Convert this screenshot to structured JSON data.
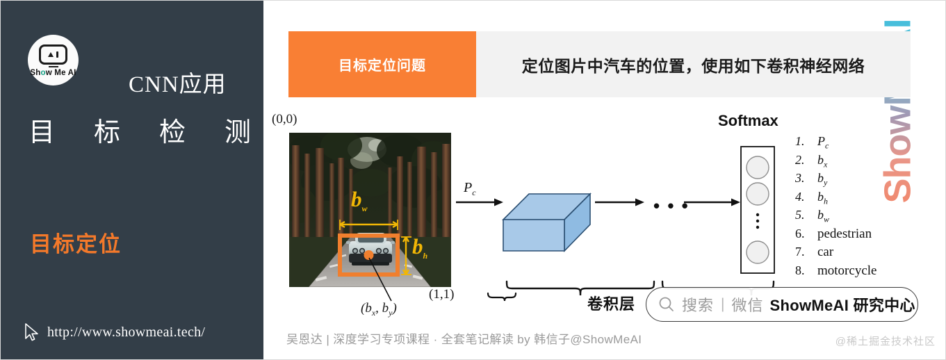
{
  "sidebar": {
    "logo": {
      "icon": "showmeai-robot-logo",
      "wordmark_pre": "Sh",
      "wordmark_dot": "o",
      "wordmark_post": "w Me AI"
    },
    "course_title": "CNN应用",
    "main_title_chars": [
      "目",
      "标",
      "检",
      "测"
    ],
    "sub_title": "目标定位",
    "site_url": "http://www.showmeai.tech/",
    "cursor_icon": "mouse-pointer-icon",
    "bg_color": "#333e48",
    "accent_color": "#f4792a"
  },
  "banner": {
    "tag": "目标定位问题",
    "text": "定位图片中汽车的位置，使用如下卷积神经网络",
    "tag_color": "#f97f34",
    "bg_color": "#f2f2f2"
  },
  "diagram": {
    "origin_label": "(0,0)",
    "end_label": "(1,1)",
    "center_label": "(bx, by)",
    "width_label": "bw",
    "height_label": "bh",
    "input_label": "Pc",
    "ellipsis": "• • •",
    "softmax_label": "Softmax",
    "conv_label": "卷积层",
    "box_color": "#f07f2e",
    "dim_color": "#f2b705",
    "cube_fill": "#a8c9e8",
    "cube_stroke": "#2b4f72",
    "photo_alt": "car-on-forest-road-photo"
  },
  "output_list": {
    "items": [
      {
        "num": "1.",
        "value": "P",
        "sub": "c",
        "italic": true
      },
      {
        "num": "2.",
        "value": "b",
        "sub": "x",
        "italic": true
      },
      {
        "num": "3.",
        "value": "b",
        "sub": "y",
        "italic": true
      },
      {
        "num": "4.",
        "value": "b",
        "sub": "h",
        "italic": true
      },
      {
        "num": "5.",
        "value": "b",
        "sub": "w",
        "italic": true
      },
      {
        "num": "6.",
        "value": "pedestrian",
        "sub": "",
        "italic": false
      },
      {
        "num": "7.",
        "value": "car",
        "sub": "",
        "italic": false
      },
      {
        "num": "8.",
        "value": "motorcycle",
        "sub": "",
        "italic": false
      }
    ]
  },
  "search_pill": {
    "icon": "search-icon",
    "placeholder": "搜索",
    "divider": "|",
    "source": "微信",
    "brand": "ShowMeAI 研究中心"
  },
  "footer": {
    "note": "吴恩达 | 深度学习专项课程 · 全套笔记解读  by 韩信子@ShowMeAI",
    "right_credit": "@稀土掘金技术社区"
  },
  "watermark": {
    "vertical_text": "ShowMeAI"
  }
}
